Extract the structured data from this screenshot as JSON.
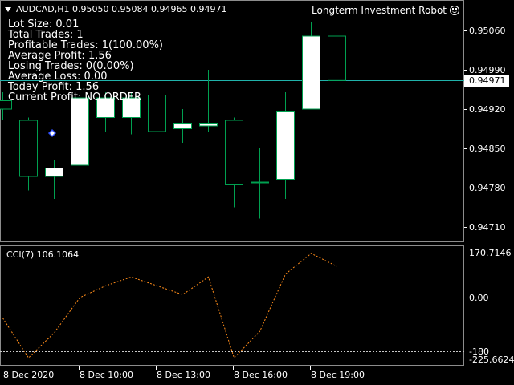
{
  "symbol_label": "AUDCAD,H1",
  "ohlc": [
    "0.95050",
    "0.95084",
    "0.94965",
    "0.94971"
  ],
  "robot_name": "Longterm Investment Robot",
  "stats": [
    "Lot Size: 0.01",
    "Total Trades: 1",
    "Profitable Trades: 1(100.00%)",
    "Average Profit: 1.56",
    "Losing  Trades: 0(0.00%)",
    "Average Loss: 0.00",
    "Today Profit: 1.56",
    "Current Profit: NO ORDER"
  ],
  "price_axis": [
    "0.95060",
    "0.94990",
    "0.94920",
    "0.94850",
    "0.94780",
    "0.94710"
  ],
  "current_price": "0.94971",
  "cci": {
    "title": "CCI(7) 106.1064",
    "axis": [
      "170.7146",
      "0.00",
      "-180",
      "-225.6624"
    ],
    "values": [
      -70,
      -205,
      -120,
      0,
      40,
      70,
      40,
      10,
      70,
      -205,
      -115,
      80,
      150,
      106
    ]
  },
  "time_axis": [
    "8 Dec 2020",
    "8 Dec 10:00",
    "8 Dec 13:00",
    "8 Dec 16:00",
    "8 Dec 19:00"
  ],
  "colors": {
    "bull_body": "#ffffff",
    "candle_border": "#00a050",
    "bid_line": "#20b2aa",
    "cci_line": "#ff8c1a",
    "level_line": "#c8c8c8"
  },
  "candles": [
    {
      "o": 0.94935,
      "h": 0.9495,
      "l": 0.949,
      "c": 0.9492
    },
    {
      "o": 0.949,
      "h": 0.94905,
      "l": 0.94775,
      "c": 0.948
    },
    {
      "o": 0.948,
      "h": 0.9483,
      "l": 0.9476,
      "c": 0.94815
    },
    {
      "o": 0.9482,
      "h": 0.9496,
      "l": 0.9476,
      "c": 0.9494
    },
    {
      "o": 0.94905,
      "h": 0.9495,
      "l": 0.9488,
      "c": 0.9494
    },
    {
      "o": 0.94905,
      "h": 0.9495,
      "l": 0.94875,
      "c": 0.9494
    },
    {
      "o": 0.94945,
      "h": 0.9498,
      "l": 0.9486,
      "c": 0.9488
    },
    {
      "o": 0.94885,
      "h": 0.9492,
      "l": 0.9486,
      "c": 0.94895
    },
    {
      "o": 0.9489,
      "h": 0.9499,
      "l": 0.9488,
      "c": 0.94895
    },
    {
      "o": 0.949,
      "h": 0.94905,
      "l": 0.94745,
      "c": 0.94785
    },
    {
      "o": 0.9479,
      "h": 0.9485,
      "l": 0.94725,
      "c": 0.9479
    },
    {
      "o": 0.94795,
      "h": 0.9495,
      "l": 0.9476,
      "c": 0.94915
    },
    {
      "o": 0.9492,
      "h": 0.95075,
      "l": 0.9492,
      "c": 0.9505
    },
    {
      "o": 0.9505,
      "h": 0.95084,
      "l": 0.94965,
      "c": 0.94971
    }
  ]
}
